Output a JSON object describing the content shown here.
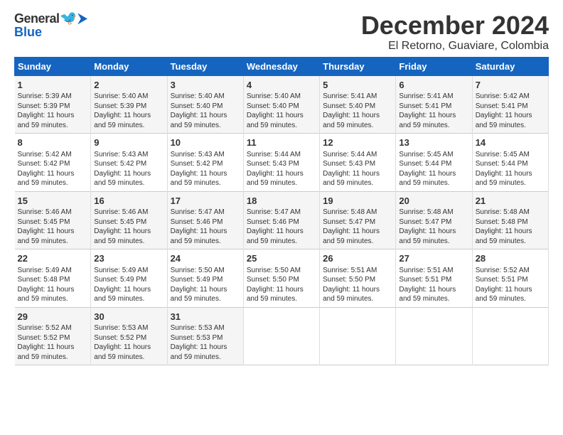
{
  "logo": {
    "general": "General",
    "blue": "Blue"
  },
  "title": "December 2024",
  "subtitle": "El Retorno, Guaviare, Colombia",
  "days_of_week": [
    "Sunday",
    "Monday",
    "Tuesday",
    "Wednesday",
    "Thursday",
    "Friday",
    "Saturday"
  ],
  "weeks": [
    [
      {
        "day": "1",
        "sunrise": "Sunrise: 5:39 AM",
        "sunset": "Sunset: 5:39 PM",
        "daylight": "Daylight: 11 hours and 59 minutes."
      },
      {
        "day": "2",
        "sunrise": "Sunrise: 5:40 AM",
        "sunset": "Sunset: 5:39 PM",
        "daylight": "Daylight: 11 hours and 59 minutes."
      },
      {
        "day": "3",
        "sunrise": "Sunrise: 5:40 AM",
        "sunset": "Sunset: 5:40 PM",
        "daylight": "Daylight: 11 hours and 59 minutes."
      },
      {
        "day": "4",
        "sunrise": "Sunrise: 5:40 AM",
        "sunset": "Sunset: 5:40 PM",
        "daylight": "Daylight: 11 hours and 59 minutes."
      },
      {
        "day": "5",
        "sunrise": "Sunrise: 5:41 AM",
        "sunset": "Sunset: 5:40 PM",
        "daylight": "Daylight: 11 hours and 59 minutes."
      },
      {
        "day": "6",
        "sunrise": "Sunrise: 5:41 AM",
        "sunset": "Sunset: 5:41 PM",
        "daylight": "Daylight: 11 hours and 59 minutes."
      },
      {
        "day": "7",
        "sunrise": "Sunrise: 5:42 AM",
        "sunset": "Sunset: 5:41 PM",
        "daylight": "Daylight: 11 hours and 59 minutes."
      }
    ],
    [
      {
        "day": "8",
        "sunrise": "Sunrise: 5:42 AM",
        "sunset": "Sunset: 5:42 PM",
        "daylight": "Daylight: 11 hours and 59 minutes."
      },
      {
        "day": "9",
        "sunrise": "Sunrise: 5:43 AM",
        "sunset": "Sunset: 5:42 PM",
        "daylight": "Daylight: 11 hours and 59 minutes."
      },
      {
        "day": "10",
        "sunrise": "Sunrise: 5:43 AM",
        "sunset": "Sunset: 5:42 PM",
        "daylight": "Daylight: 11 hours and 59 minutes."
      },
      {
        "day": "11",
        "sunrise": "Sunrise: 5:44 AM",
        "sunset": "Sunset: 5:43 PM",
        "daylight": "Daylight: 11 hours and 59 minutes."
      },
      {
        "day": "12",
        "sunrise": "Sunrise: 5:44 AM",
        "sunset": "Sunset: 5:43 PM",
        "daylight": "Daylight: 11 hours and 59 minutes."
      },
      {
        "day": "13",
        "sunrise": "Sunrise: 5:45 AM",
        "sunset": "Sunset: 5:44 PM",
        "daylight": "Daylight: 11 hours and 59 minutes."
      },
      {
        "day": "14",
        "sunrise": "Sunrise: 5:45 AM",
        "sunset": "Sunset: 5:44 PM",
        "daylight": "Daylight: 11 hours and 59 minutes."
      }
    ],
    [
      {
        "day": "15",
        "sunrise": "Sunrise: 5:46 AM",
        "sunset": "Sunset: 5:45 PM",
        "daylight": "Daylight: 11 hours and 59 minutes."
      },
      {
        "day": "16",
        "sunrise": "Sunrise: 5:46 AM",
        "sunset": "Sunset: 5:45 PM",
        "daylight": "Daylight: 11 hours and 59 minutes."
      },
      {
        "day": "17",
        "sunrise": "Sunrise: 5:47 AM",
        "sunset": "Sunset: 5:46 PM",
        "daylight": "Daylight: 11 hours and 59 minutes."
      },
      {
        "day": "18",
        "sunrise": "Sunrise: 5:47 AM",
        "sunset": "Sunset: 5:46 PM",
        "daylight": "Daylight: 11 hours and 59 minutes."
      },
      {
        "day": "19",
        "sunrise": "Sunrise: 5:48 AM",
        "sunset": "Sunset: 5:47 PM",
        "daylight": "Daylight: 11 hours and 59 minutes."
      },
      {
        "day": "20",
        "sunrise": "Sunrise: 5:48 AM",
        "sunset": "Sunset: 5:47 PM",
        "daylight": "Daylight: 11 hours and 59 minutes."
      },
      {
        "day": "21",
        "sunrise": "Sunrise: 5:48 AM",
        "sunset": "Sunset: 5:48 PM",
        "daylight": "Daylight: 11 hours and 59 minutes."
      }
    ],
    [
      {
        "day": "22",
        "sunrise": "Sunrise: 5:49 AM",
        "sunset": "Sunset: 5:48 PM",
        "daylight": "Daylight: 11 hours and 59 minutes."
      },
      {
        "day": "23",
        "sunrise": "Sunrise: 5:49 AM",
        "sunset": "Sunset: 5:49 PM",
        "daylight": "Daylight: 11 hours and 59 minutes."
      },
      {
        "day": "24",
        "sunrise": "Sunrise: 5:50 AM",
        "sunset": "Sunset: 5:49 PM",
        "daylight": "Daylight: 11 hours and 59 minutes."
      },
      {
        "day": "25",
        "sunrise": "Sunrise: 5:50 AM",
        "sunset": "Sunset: 5:50 PM",
        "daylight": "Daylight: 11 hours and 59 minutes."
      },
      {
        "day": "26",
        "sunrise": "Sunrise: 5:51 AM",
        "sunset": "Sunset: 5:50 PM",
        "daylight": "Daylight: 11 hours and 59 minutes."
      },
      {
        "day": "27",
        "sunrise": "Sunrise: 5:51 AM",
        "sunset": "Sunset: 5:51 PM",
        "daylight": "Daylight: 11 hours and 59 minutes."
      },
      {
        "day": "28",
        "sunrise": "Sunrise: 5:52 AM",
        "sunset": "Sunset: 5:51 PM",
        "daylight": "Daylight: 11 hours and 59 minutes."
      }
    ],
    [
      {
        "day": "29",
        "sunrise": "Sunrise: 5:52 AM",
        "sunset": "Sunset: 5:52 PM",
        "daylight": "Daylight: 11 hours and 59 minutes."
      },
      {
        "day": "30",
        "sunrise": "Sunrise: 5:53 AM",
        "sunset": "Sunset: 5:52 PM",
        "daylight": "Daylight: 11 hours and 59 minutes."
      },
      {
        "day": "31",
        "sunrise": "Sunrise: 5:53 AM",
        "sunset": "Sunset: 5:53 PM",
        "daylight": "Daylight: 11 hours and 59 minutes."
      },
      null,
      null,
      null,
      null
    ]
  ]
}
